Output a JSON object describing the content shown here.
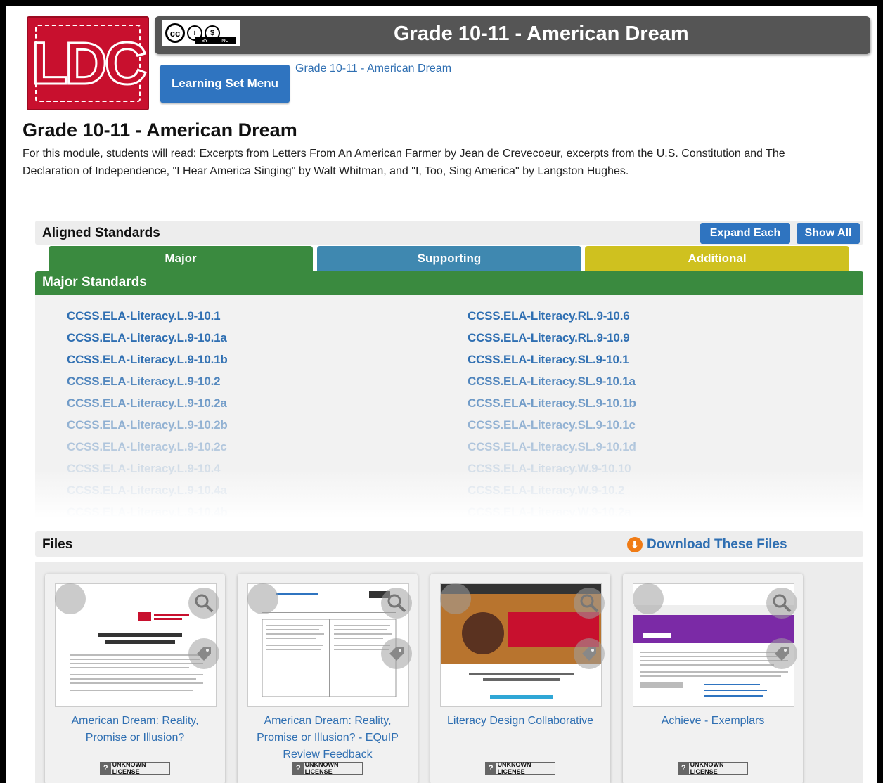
{
  "header": {
    "logo_text": "LDC",
    "title": "Grade 10-11 - American Dream",
    "cc_labels": [
      "BY",
      "NC"
    ],
    "learning_set_menu_label": "Learning Set Menu",
    "breadcrumb": "Grade 10-11 - American Dream"
  },
  "module": {
    "title": "Grade 10-11 - American Dream",
    "description": "For this module, students will read: Excerpts from Letters From An American Farmer by Jean de Crevecoeur, excerpts from the U.S. Constitution and The Declaration of Independence, \"I Hear America Singing\" by Walt Whitman, and \"I, Too, Sing America\" by Langston Hughes."
  },
  "standards": {
    "section_label": "Aligned Standards",
    "expand_each_label": "Expand Each",
    "show_all_label": "Show All",
    "tabs": [
      {
        "label": "Major",
        "color": "#3a8a3f"
      },
      {
        "label": "Supporting",
        "color": "#3f88b0"
      },
      {
        "label": "Additional",
        "color": "#cfc11f"
      }
    ],
    "panel_title": "Major Standards",
    "left_column": [
      "CCSS.ELA-Literacy.L.9-10.1",
      "CCSS.ELA-Literacy.L.9-10.1a",
      "CCSS.ELA-Literacy.L.9-10.1b",
      "CCSS.ELA-Literacy.L.9-10.2",
      "CCSS.ELA-Literacy.L.9-10.2a",
      "CCSS.ELA-Literacy.L.9-10.2b",
      "CCSS.ELA-Literacy.L.9-10.2c",
      "CCSS.ELA-Literacy.L.9-10.4",
      "CCSS.ELA-Literacy.L.9-10.4a",
      "CCSS.ELA-Literacy.L.9-10.4b"
    ],
    "right_column": [
      "CCSS.ELA-Literacy.RL.9-10.6",
      "CCSS.ELA-Literacy.RL.9-10.9",
      "CCSS.ELA-Literacy.SL.9-10.1",
      "CCSS.ELA-Literacy.SL.9-10.1a",
      "CCSS.ELA-Literacy.SL.9-10.1b",
      "CCSS.ELA-Literacy.SL.9-10.1c",
      "CCSS.ELA-Literacy.SL.9-10.1d",
      "CCSS.ELA-Literacy.W.9-10.10",
      "CCSS.ELA-Literacy.W.9-10.2",
      "CCSS.ELA-Literacy.W.9-10.2a"
    ]
  },
  "files": {
    "section_label": "Files",
    "download_label": "Download These Files",
    "license_label": "UNKNOWN LICENSE",
    "cards": [
      {
        "title": "American Dream: Reality, Promise or Illusion?"
      },
      {
        "title": "American Dream: Reality, Promise or Illusion? - EQuIP Review Feedback"
      },
      {
        "title": "Literacy Design Collaborative"
      },
      {
        "title": "Achieve - Exemplars"
      }
    ]
  }
}
